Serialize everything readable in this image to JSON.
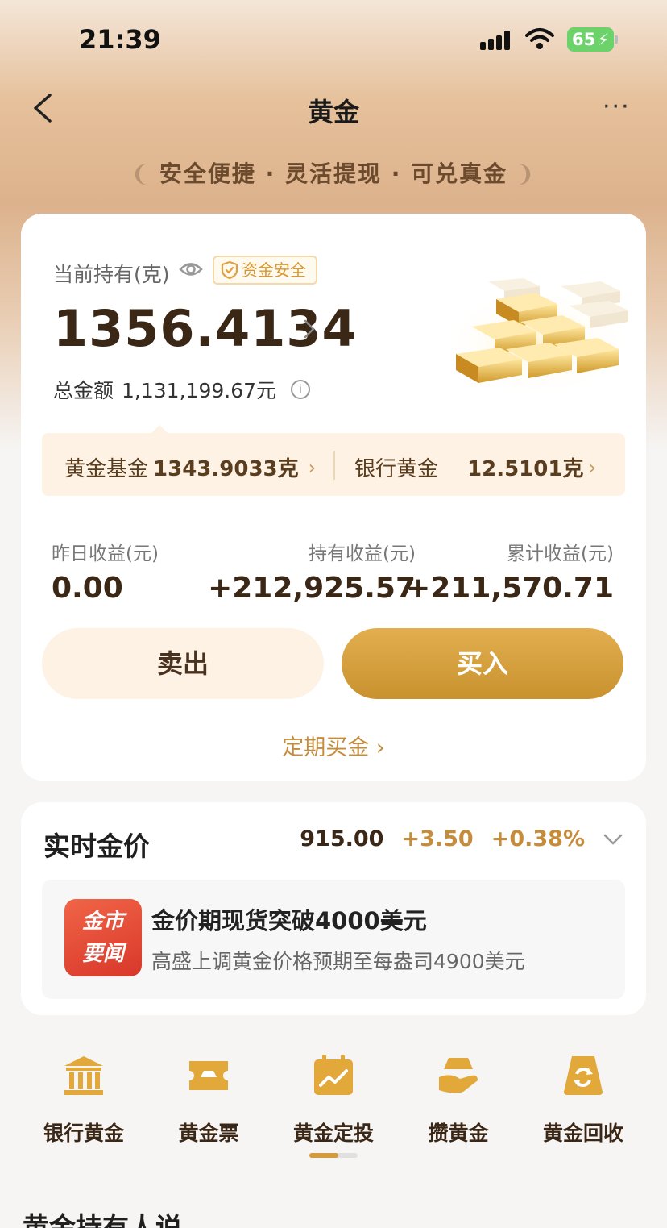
{
  "status_bar": {
    "time": "21:39",
    "battery": "65"
  },
  "nav": {
    "title": "黄金"
  },
  "slogan": "安全便捷 · 灵活提现 · 可兑真金",
  "holding": {
    "label": "当前持有(克)",
    "badge": "资金安全",
    "grams": "1356.4134",
    "total_label": "总金额",
    "total_value": "1,131,199.67元",
    "fund_label": "黄金基金",
    "fund_value": "1343.9033克",
    "bank_label": "银行黄金",
    "bank_value": "12.5101克"
  },
  "earnings": [
    {
      "label": "昨日收益(元)",
      "value": "0.00"
    },
    {
      "label": "持有收益(元)",
      "value": "+212,925.57"
    },
    {
      "label": "累计收益(元)",
      "value": "+211,570.71"
    }
  ],
  "actions": {
    "sell": "卖出",
    "buy": "买入",
    "regular": "定期买金"
  },
  "price": {
    "title": "实时金价",
    "value": "915.00",
    "change": "+3.50",
    "change_pct": "+0.38%"
  },
  "news": {
    "logo_line1": "金市",
    "logo_line2": "要闻",
    "title": "金价期现货突破4000美元",
    "subtitle": "高盛上调黄金价格预期至每盎司4900美元"
  },
  "shortcuts": [
    {
      "label": "银行黄金",
      "icon": "bank-icon"
    },
    {
      "label": "黄金票",
      "icon": "ticket-icon"
    },
    {
      "label": "黄金定投",
      "icon": "calendar-chart-icon"
    },
    {
      "label": "攒黄金",
      "icon": "hand-gold-icon"
    },
    {
      "label": "黄金回收",
      "icon": "recycle-icon"
    }
  ],
  "section_title": "黄金持有人说",
  "colors": {
    "gold": "#c9922f",
    "accent_text": "#c58c3c",
    "dark_brown": "#3a2716"
  }
}
